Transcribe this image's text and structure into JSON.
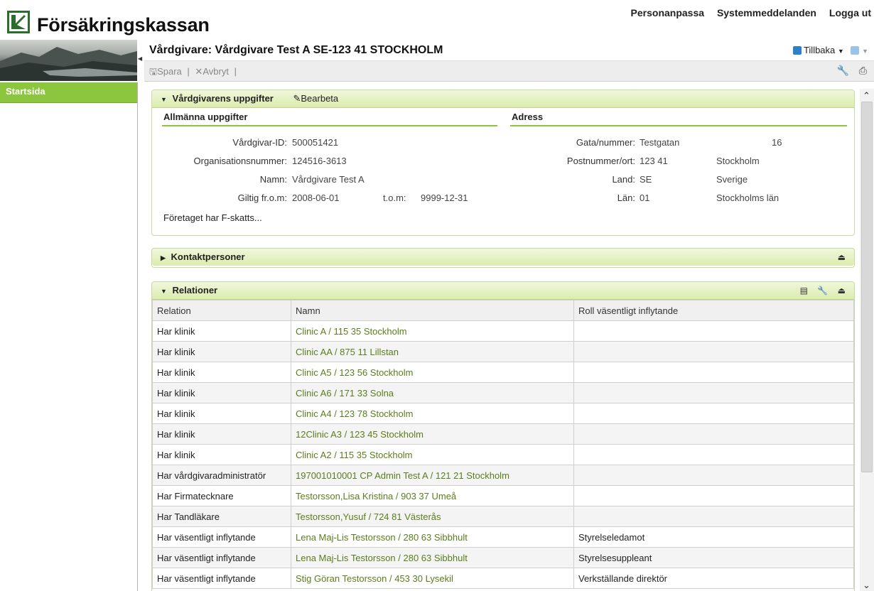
{
  "brand": {
    "name": "Försäkringskassan",
    "logo_icon": "fk-logo-icon",
    "accent": "#8cc63f"
  },
  "topnav": {
    "personalize": "Personanpassa",
    "system_messages": "Systemmeddelanden",
    "logout": "Logga ut"
  },
  "sidebar": {
    "items": [
      {
        "label": "Startsida"
      }
    ]
  },
  "page": {
    "title": "Vårdgivare: Vårdgivare Test A SE-123 41 STOCKHOLM",
    "back_label": "Tillbaka"
  },
  "toolbar": {
    "save_label": "Spara",
    "cancel_label": "Avbryt"
  },
  "provider_panel": {
    "title": "Vårdgivarens uppgifter",
    "edit_label": "Bearbeta",
    "general": {
      "title": "Allmänna uppgifter",
      "id_label": "Vårdgivar-ID:",
      "id_value": "500051421",
      "orgnr_label": "Organisationsnummer:",
      "orgnr_value": "124516-3613",
      "name_label": "Namn:",
      "name_value": "Vårdgivare Test A",
      "valid_from_label": "Giltig fr.o.m:",
      "valid_from_value": "2008-06-01",
      "valid_to_label": "t.o.m:",
      "valid_to_value": "9999-12-31",
      "tax_note": "Företaget har F-skatts..."
    },
    "address": {
      "title": "Adress",
      "street_label": "Gata/nummer:",
      "street_value": "Testgatan",
      "street_number": "16",
      "postal_label": "Postnummer/ort:",
      "postal_code": "123 41",
      "city": "Stockholm",
      "country_label": "Land:",
      "country_code": "SE",
      "country_name": "Sverige",
      "county_label": "Län:",
      "county_code": "01",
      "county_name": "Stockholms län"
    }
  },
  "contacts_panel": {
    "title": "Kontaktpersoner"
  },
  "relations_panel": {
    "title": "Relationer",
    "columns": [
      "Relation",
      "Namn",
      "Roll väsentligt inflytande"
    ],
    "rows": [
      {
        "relation": "Har klinik",
        "name": "Clinic A / 115 35 Stockholm",
        "role": ""
      },
      {
        "relation": "Har klinik",
        "name": "Clinic AA / 875 11 Lillstan",
        "role": ""
      },
      {
        "relation": "Har klinik",
        "name": "Clinic A5 / 123 56 Stockholm",
        "role": ""
      },
      {
        "relation": "Har klinik",
        "name": "Clinic A6 / 171 33 Solna",
        "role": ""
      },
      {
        "relation": "Har klinik",
        "name": "Clinic A4 / 123 78 Stockholm",
        "role": ""
      },
      {
        "relation": "Har klinik",
        "name": "12Clinic A3 / 123 45 Stockholm",
        "role": ""
      },
      {
        "relation": "Har klinik",
        "name": "Clinic A2 / 115 35 Stockholm",
        "role": ""
      },
      {
        "relation": "Har vårdgivaradministratör",
        "name": "197001010001 CP Admin Test A / 121 21 Stockholm",
        "role": ""
      },
      {
        "relation": "Har Firmatecknare",
        "name": "Testorsson,Lisa Kristina / 903 37 Umeå",
        "role": ""
      },
      {
        "relation": "Har Tandläkare",
        "name": "Testorsson,Yusuf / 724 81 Västerås",
        "role": ""
      },
      {
        "relation": "Har väsentligt inflytande",
        "name": "Lena Maj-Lis Testorsson / 280 63 Sibbhult",
        "role": "Styrelseledamot"
      },
      {
        "relation": "Har väsentligt inflytande",
        "name": "Lena Maj-Lis Testorsson / 280 63 Sibbhult",
        "role": "Styrelsesuppleant"
      },
      {
        "relation": "Har väsentligt inflytande",
        "name": "Stig Göran Testorsson / 453 30 Lysekil",
        "role": "Verkställande direktör"
      }
    ]
  }
}
